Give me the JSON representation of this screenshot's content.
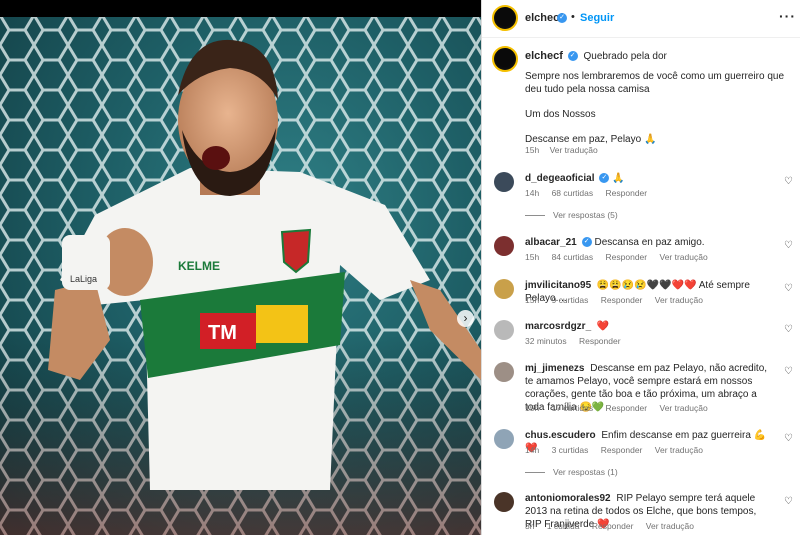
{
  "post": {
    "username": "elchecf",
    "follow_label": "Seguir",
    "more_icon": "more-horizontal-icon",
    "next_icon": "chevron-right-icon",
    "photo_texts": {
      "brand": "KELME",
      "sponsor": "TM",
      "sleeve": "LaLiga"
    },
    "colors": {
      "accent": "#0095f6",
      "verified": "#3897f0",
      "jersey_green": "#1b7a3a",
      "sponsor_red": "#d21f26",
      "sponsor_yellow": "#f3c316"
    }
  },
  "caption": {
    "username": "elchecf",
    "first_line": "Quebrado pela dor",
    "paragraphs": [
      "Sempre nos lembraremos de você como um guerreiro que deu tudo pela nossa camisa",
      "Um dos Nossos",
      "Descanse em paz, Pelayo 🙏"
    ],
    "time": "15h",
    "translate": "Ver tradução"
  },
  "comments": [
    {
      "username": "d_degeaoficial",
      "verified": true,
      "text": "🙏",
      "time": "14h",
      "likes": "68 curtidas",
      "reply": "Responder",
      "translate": "",
      "replies": "Ver respostas (5)"
    },
    {
      "username": "albacar_21",
      "verified": true,
      "text": "Descansa en paz amigo.",
      "time": "15h",
      "likes": "84 curtidas",
      "reply": "Responder",
      "translate": "Ver tradução",
      "replies": ""
    },
    {
      "username": "jmvilicitano95",
      "verified": false,
      "text": "😩😩😢😢🖤🖤❤️❤️ Até sempre Pelayo....",
      "time": "15h",
      "likes": "9 curtidas",
      "reply": "Responder",
      "translate": "Ver tradução",
      "replies": ""
    },
    {
      "username": "marcosrdgzr_",
      "verified": false,
      "text": "❤️",
      "time": "32 minutos",
      "likes": "",
      "reply": "Responder",
      "translate": "",
      "replies": ""
    },
    {
      "username": "mj_jimenezs",
      "verified": false,
      "text": "Descanse em paz Pelayo, não acredito, te amamos Pelayo, você sempre estará em nossos corações, gente tão boa e tão próxima, um abraço a toda família 😔💚",
      "time": "15h",
      "likes": "17 curtidas",
      "reply": "Responder",
      "translate": "Ver tradução",
      "replies": ""
    },
    {
      "username": "chus.escudero",
      "verified": false,
      "text": "Enfim descanse em paz guerreira 💪❤️",
      "time": "14h",
      "likes": "3 curtidas",
      "reply": "Responder",
      "translate": "Ver tradução",
      "replies": "Ver respostas (1)"
    },
    {
      "username": "antoniomorales92",
      "verified": false,
      "text": "RIP Pelayo sempre terá aquele 2013 na retina de todos os Elche, que bons tempos, RIP Franjiverde ❤️",
      "time": "3h",
      "likes": "1 curtida",
      "reply": "Responder",
      "translate": "Ver tradução",
      "replies": ""
    }
  ]
}
